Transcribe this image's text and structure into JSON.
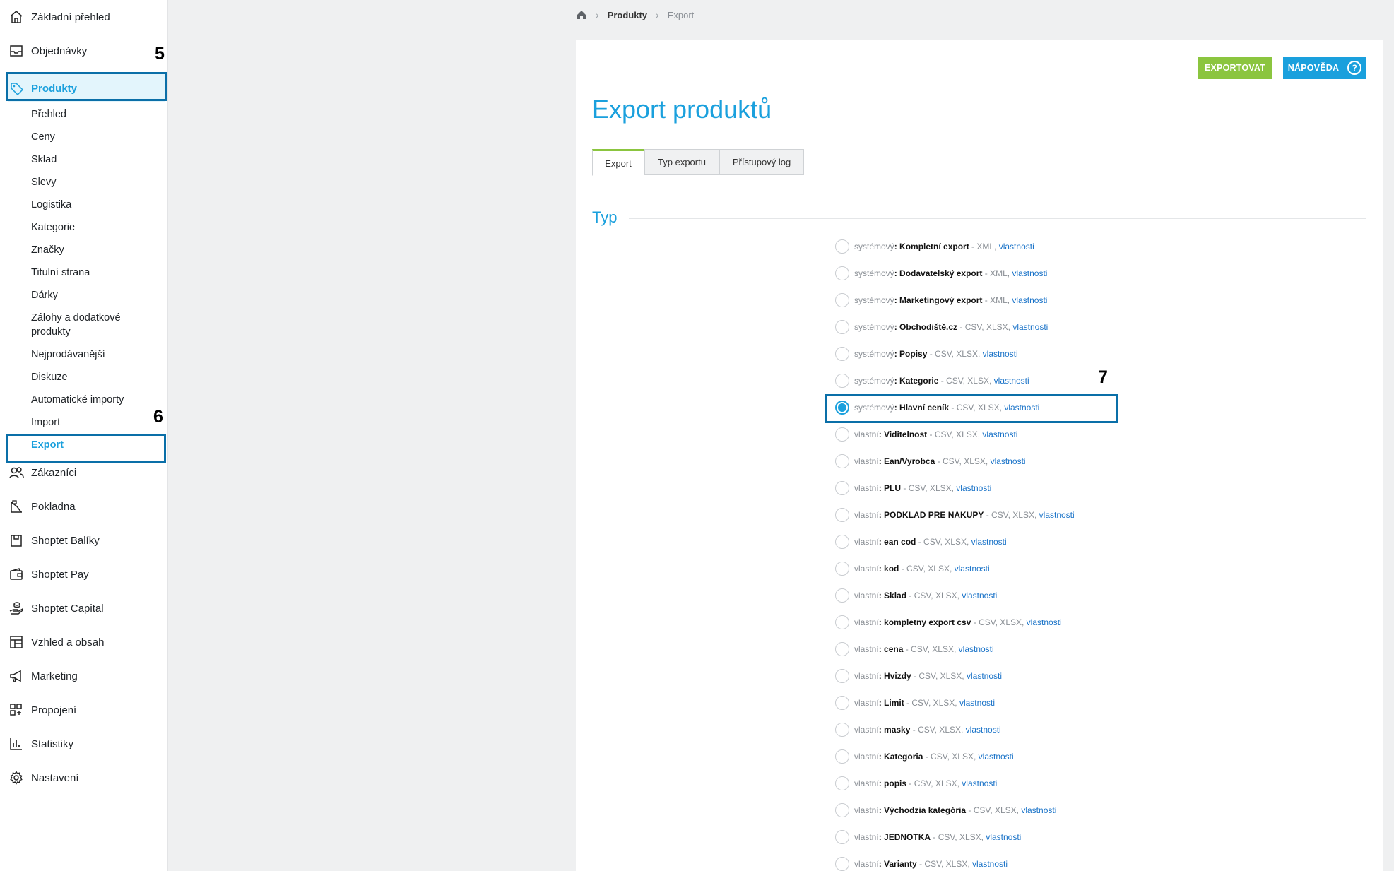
{
  "sidebar": {
    "items": [
      {
        "label": "Základní přehled",
        "icon": "home-icon"
      },
      {
        "label": "Objednávky",
        "icon": "inbox-icon"
      },
      {
        "label": "Produkty",
        "icon": "tag-icon"
      },
      {
        "label": "Zákazníci",
        "icon": "users-icon"
      },
      {
        "label": "Pokladna",
        "icon": "cash-register-icon"
      },
      {
        "label": "Shoptet Balíky",
        "icon": "package-icon"
      },
      {
        "label": "Shoptet Pay",
        "icon": "wallet-icon"
      },
      {
        "label": "Shoptet Capital",
        "icon": "coins-hand-icon"
      },
      {
        "label": "Vzhled a obsah",
        "icon": "layout-icon"
      },
      {
        "label": "Marketing",
        "icon": "megaphone-icon"
      },
      {
        "label": "Propojení",
        "icon": "grid-plus-icon"
      },
      {
        "label": "Statistiky",
        "icon": "bar-chart-icon"
      },
      {
        "label": "Nastavení",
        "icon": "gear-icon"
      }
    ],
    "products_sub": [
      "Přehled",
      "Ceny",
      "Sklad",
      "Slevy",
      "Logistika",
      "Kategorie",
      "Značky",
      "Titulní strana",
      "Dárky",
      "Zálohy a dodatkové produkty",
      "Nejprodávanější",
      "Diskuze",
      "Automatické importy",
      "Import",
      "Export"
    ]
  },
  "annotations": {
    "step5": "5",
    "step6": "6",
    "step7": "7",
    "box_color": "#0a6fa8"
  },
  "breadcrumb": {
    "home_icon": "home-icon",
    "level1": "Produkty",
    "level2": "Export"
  },
  "toolbar": {
    "export_label": "EXPORTOVAT",
    "help_label": "NÁPOVĚDA",
    "help_icon": "?"
  },
  "page": {
    "title": "Export produktů"
  },
  "tabs": [
    "Export",
    "Typ exportu",
    "Přístupový log"
  ],
  "section": {
    "title": "Typ"
  },
  "options": [
    {
      "prefix": "systémový",
      "name": "Kompletní export",
      "formats": " - XML, ",
      "link": "vlastnosti",
      "checked": false
    },
    {
      "prefix": "systémový",
      "name": "Dodavatelský export",
      "formats": " - XML, ",
      "link": "vlastnosti",
      "checked": false
    },
    {
      "prefix": "systémový",
      "name": "Marketingový export",
      "formats": " - XML, ",
      "link": "vlastnosti",
      "checked": false
    },
    {
      "prefix": "systémový",
      "name": "Obchodiště.cz",
      "formats": " - CSV, XLSX, ",
      "link": "vlastnosti",
      "checked": false
    },
    {
      "prefix": "systémový",
      "name": "Popisy",
      "formats": " - CSV, XLSX, ",
      "link": "vlastnosti",
      "checked": false
    },
    {
      "prefix": "systémový",
      "name": "Kategorie",
      "formats": " - CSV, XLSX, ",
      "link": "vlastnosti",
      "checked": false
    },
    {
      "prefix": "systémový",
      "name": "Hlavní ceník",
      "formats": " - CSV, XLSX, ",
      "link": "vlastnosti",
      "checked": true
    },
    {
      "prefix": "vlastní",
      "name": "Viditelnost",
      "formats": " - CSV, XLSX, ",
      "link": "vlastnosti",
      "checked": false
    },
    {
      "prefix": "vlastní",
      "name": "Ean/Vyrobca",
      "formats": " - CSV, XLSX, ",
      "link": "vlastnosti",
      "checked": false
    },
    {
      "prefix": "vlastní",
      "name": "PLU",
      "formats": " - CSV, XLSX, ",
      "link": "vlastnosti",
      "checked": false
    },
    {
      "prefix": "vlastní",
      "name": "PODKLAD PRE NAKUPY",
      "formats": " - CSV, XLSX, ",
      "link": "vlastnosti",
      "checked": false
    },
    {
      "prefix": "vlastní",
      "name": "ean cod",
      "formats": " - CSV, XLSX, ",
      "link": "vlastnosti",
      "checked": false
    },
    {
      "prefix": "vlastní",
      "name": "kod",
      "formats": " - CSV, XLSX, ",
      "link": "vlastnosti",
      "checked": false
    },
    {
      "prefix": "vlastní",
      "name": "Sklad",
      "formats": " - CSV, XLSX, ",
      "link": "vlastnosti",
      "checked": false
    },
    {
      "prefix": "vlastní",
      "name": "kompletny export csv",
      "formats": " - CSV, XLSX, ",
      "link": "vlastnosti",
      "checked": false
    },
    {
      "prefix": "vlastní",
      "name": "cena",
      "formats": " - CSV, XLSX, ",
      "link": "vlastnosti",
      "checked": false
    },
    {
      "prefix": "vlastní",
      "name": "Hvizdy",
      "formats": " - CSV, XLSX, ",
      "link": "vlastnosti",
      "checked": false
    },
    {
      "prefix": "vlastní",
      "name": "Limit",
      "formats": " - CSV, XLSX, ",
      "link": "vlastnosti",
      "checked": false
    },
    {
      "prefix": "vlastní",
      "name": "masky",
      "formats": " - CSV, XLSX, ",
      "link": "vlastnosti",
      "checked": false
    },
    {
      "prefix": "vlastní",
      "name": "Kategoria",
      "formats": " - CSV, XLSX, ",
      "link": "vlastnosti",
      "checked": false
    },
    {
      "prefix": "vlastní",
      "name": "popis",
      "formats": " - CSV, XLSX, ",
      "link": "vlastnosti",
      "checked": false
    },
    {
      "prefix": "vlastní",
      "name": "Východzia kategória",
      "formats": " - CSV, XLSX, ",
      "link": "vlastnosti",
      "checked": false
    },
    {
      "prefix": "vlastní",
      "name": "JEDNOTKA",
      "formats": " - CSV, XLSX, ",
      "link": "vlastnosti",
      "checked": false
    },
    {
      "prefix": "vlastní",
      "name": "Varianty",
      "formats": " - CSV, XLSX, ",
      "link": "vlastnosti",
      "checked": false
    }
  ],
  "colors": {
    "accent": "#1aa0dd",
    "export_button": "#8bc53f",
    "link": "#1a73c8"
  }
}
